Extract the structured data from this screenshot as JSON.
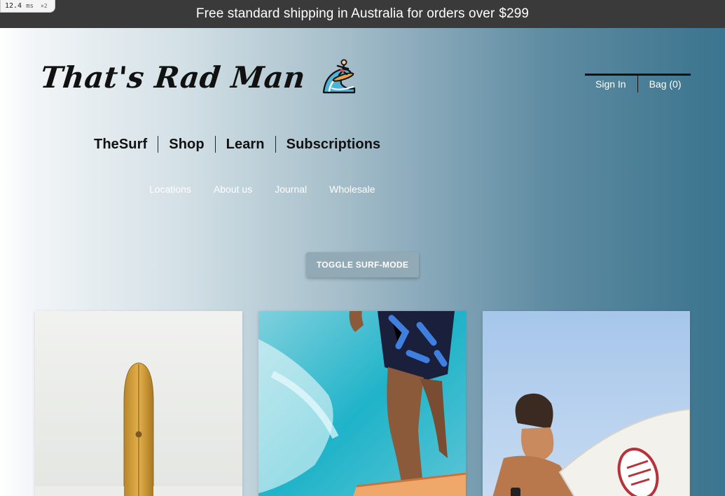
{
  "perf_badge": {
    "value": "12.4",
    "unit": "ms",
    "multiplier": "×2"
  },
  "promo": {
    "text_prefix": "Free standard shipping in Australia for orders over",
    "amount": "$299"
  },
  "brand": {
    "name": "That's Rad Man",
    "icon": "surfer-wave-icon"
  },
  "account": {
    "sign_in": "Sign In",
    "bag": "Bag (0)"
  },
  "main_nav": [
    {
      "label": "TheSurf"
    },
    {
      "label": "Shop"
    },
    {
      "label": "Learn"
    },
    {
      "label": "Subscriptions"
    }
  ],
  "sub_nav": [
    {
      "label": "Locations"
    },
    {
      "label": "About us"
    },
    {
      "label": "Journal"
    },
    {
      "label": "Wholesale"
    }
  ],
  "toggle": {
    "label": "TOGGLE SURF-MODE"
  },
  "colors": {
    "promo_bg": "#3a3a3a",
    "hero_gradient_start": "#ffffff",
    "hero_gradient_end": "#3b7590",
    "toggle_bg": "#92a9b6"
  },
  "cards": [
    {
      "image": "yellow-surfboard-photo"
    },
    {
      "image": "surfer-legs-on-board-photo"
    },
    {
      "image": "surfer-holding-board-photo"
    }
  ]
}
